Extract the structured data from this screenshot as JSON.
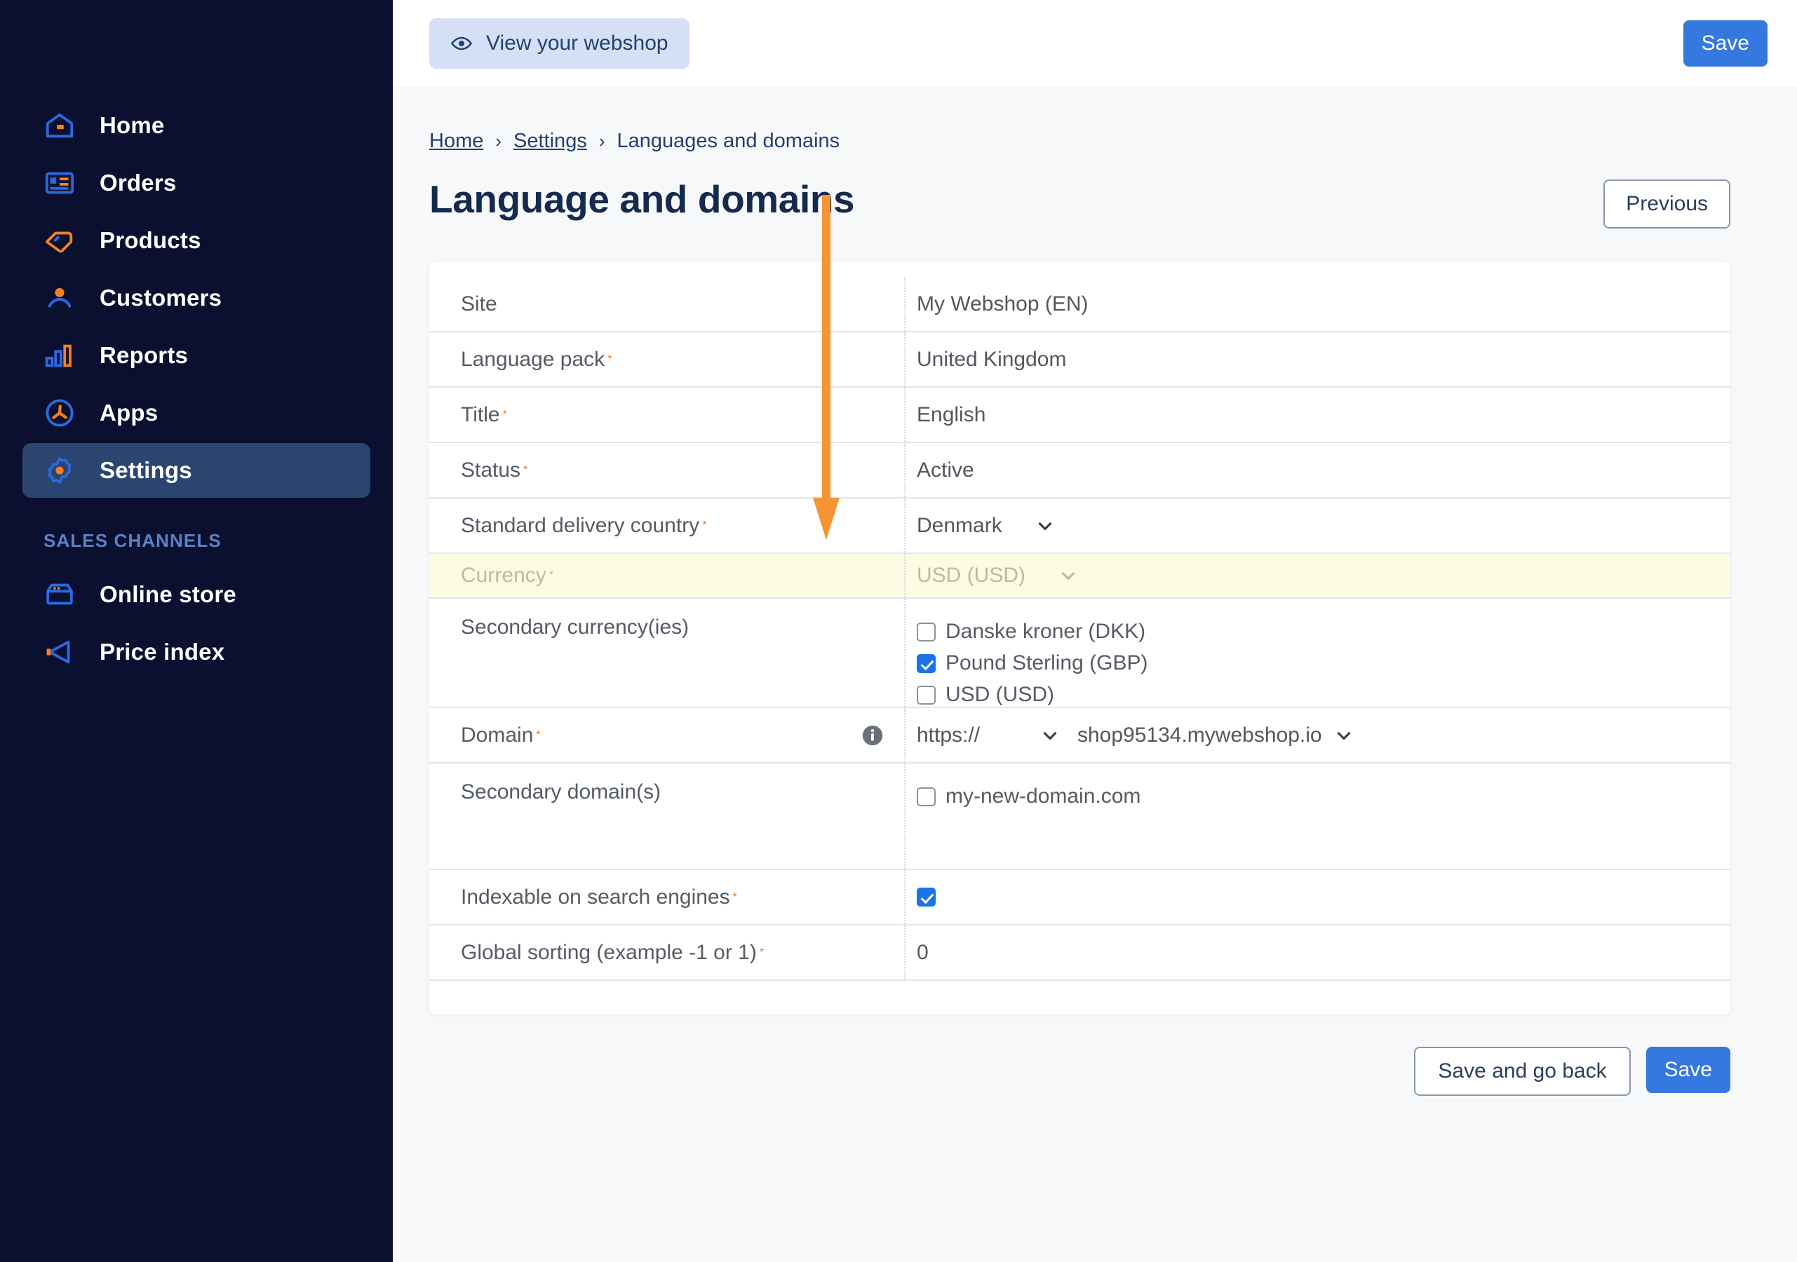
{
  "sidebar": {
    "items": [
      {
        "label": "Home",
        "icon": "home-icon",
        "active": false
      },
      {
        "label": "Orders",
        "icon": "orders-icon",
        "active": false
      },
      {
        "label": "Products",
        "icon": "tag-icon",
        "active": false
      },
      {
        "label": "Customers",
        "icon": "user-icon",
        "active": false
      },
      {
        "label": "Reports",
        "icon": "bar-chart-icon",
        "active": false
      },
      {
        "label": "Apps",
        "icon": "apps-icon",
        "active": false
      },
      {
        "label": "Settings",
        "icon": "gear-icon",
        "active": true
      }
    ],
    "section_title": "SALES CHANNELS",
    "channels": [
      {
        "label": "Online store",
        "icon": "store-icon"
      },
      {
        "label": "Price index",
        "icon": "megaphone-icon"
      }
    ]
  },
  "topbar": {
    "view_webshop_label": "View your webshop",
    "view_webshop_icon": "eye-icon",
    "save_label": "Save"
  },
  "breadcrumb": {
    "home": "Home",
    "settings": "Settings",
    "current": "Languages and domains",
    "separator": "›"
  },
  "page": {
    "title": "Language and domains",
    "previous_label": "Previous"
  },
  "form": {
    "rows": [
      {
        "label": "Site",
        "required": false,
        "value": "My Webshop (EN)",
        "type": "text"
      },
      {
        "label": "Language pack",
        "required": true,
        "value": "United Kingdom",
        "type": "text"
      },
      {
        "label": "Title",
        "required": true,
        "value": "English",
        "type": "text"
      },
      {
        "label": "Status",
        "required": true,
        "value": "Active",
        "type": "text"
      },
      {
        "label": "Standard delivery country",
        "required": true,
        "value": "Denmark",
        "type": "select"
      },
      {
        "label": "Currency",
        "required": true,
        "value": "USD (USD)",
        "type": "select",
        "highlighted": true
      },
      {
        "label": "Secondary currency(ies)",
        "required": false,
        "type": "checkbox-group"
      },
      {
        "label": "Domain",
        "required": true,
        "type": "domain",
        "info_icon": "info-icon"
      },
      {
        "label": "Secondary domain(s)",
        "required": false,
        "type": "checkbox-group"
      },
      {
        "label": "Indexable on search engines",
        "required": true,
        "type": "checkbox"
      },
      {
        "label": "Global sorting (example -1 or 1)",
        "required": true,
        "value": "0",
        "type": "text"
      }
    ],
    "secondary_currencies": [
      {
        "label": "Danske kroner (DKK)",
        "checked": false
      },
      {
        "label": "Pound Sterling (GBP)",
        "checked": true
      },
      {
        "label": "USD (USD)",
        "checked": false
      }
    ],
    "domain": {
      "protocol": "https://",
      "host": "shop95134.mywebshop.io"
    },
    "secondary_domains": [
      {
        "label": "my-new-domain.com",
        "checked": false
      }
    ],
    "indexable_checked": true,
    "required_marker": "*"
  },
  "footer": {
    "save_and_go_back_label": "Save and go back",
    "save_label": "Save"
  },
  "colors": {
    "sidebar_bg": "#0b1030",
    "sidebar_active": "#2a4670",
    "accent_blue": "#3478e0",
    "accent_orange": "#f59432",
    "highlight_row": "#fcfce4",
    "title": "#152a4e"
  }
}
